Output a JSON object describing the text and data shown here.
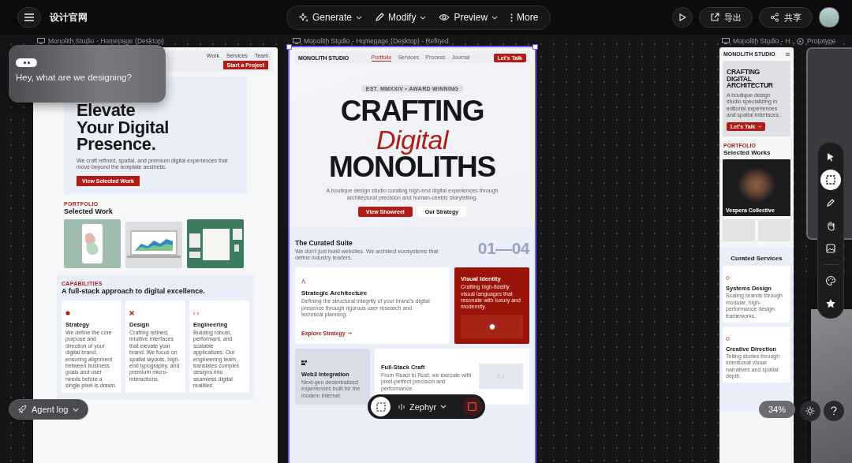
{
  "top_bar": {
    "project_title": "设计官网",
    "menu": [
      {
        "kind": "generate",
        "label": "Generate"
      },
      {
        "kind": "modify",
        "label": "Modify"
      },
      {
        "kind": "preview",
        "label": "Preview"
      },
      {
        "kind": "more",
        "label": "More"
      }
    ],
    "export_label": "导出",
    "share_label": "共享"
  },
  "chat_bubble": {
    "message": "Hey, what are we designing?"
  },
  "frames": [
    {
      "kind": "desktop",
      "title": "Monolith Studio - Homepage (Desktop)",
      "selected": false,
      "nav_links": [
        "Work",
        "Services",
        "Team"
      ],
      "nav_cta": "Start a Project",
      "hero_lines": [
        "Elevate",
        "Your Digital",
        "Presence."
      ],
      "hero_text": "We craft refined, spatial, and premium digital experiences that move beyond the template aesthetic.",
      "hero_button": "View Selected Work",
      "portfolio_eyebrow": "PORTFOLIO",
      "portfolio_title": "Selected Work",
      "capabilities_eyebrow": "CAPABILITIES",
      "capabilities_title": "A full-stack approach to digital excellence.",
      "capabilities": [
        {
          "kind": "strategy",
          "title": "Strategy",
          "text": "We define the core purpose and direction of your digital brand, ensuring alignment between business goals and user needs before a single pixel is drawn."
        },
        {
          "kind": "design",
          "title": "Design",
          "text": "Crafting refined, intuitive interfaces that elevate your brand. We focus on spatial layouts, high-end typography, and premium micro-interactions."
        },
        {
          "kind": "engineering",
          "title": "Engineering",
          "text": "Building robust, performant, and scalable applications. Our engineering team translates complex designs into seamless digital realities."
        }
      ]
    },
    {
      "kind": "refined",
      "title": "Monolith Studio - Homepage (Desktop) - Refined",
      "selected": true,
      "logo": "MONOLITH STUDIO",
      "nav_links": [
        {
          "label": "Portfolio",
          "selected": true
        },
        {
          "label": "Services",
          "selected": false
        },
        {
          "label": "Process",
          "selected": false
        },
        {
          "label": "Journal",
          "selected": false
        }
      ],
      "nav_cta": "Let's Talk",
      "badge": "EST. MMXXIV • AWARD WINNING",
      "headline": [
        "CRAFTING",
        "Digital",
        "MONOLITHS"
      ],
      "hero_text": "A boutique design studio curating high-end digital experiences through architectural precision and human-centric storytelling.",
      "primary_button": "View Showreel",
      "secondary_button": "Our Strategy",
      "suite_title": "The Curated Suite",
      "suite_text": "We don't just build websites. We architect ecosystems that define industry leaders.",
      "suite_counter": "01—04",
      "services": [
        {
          "kind": "feature",
          "title": "Strategic Architecture",
          "text": "Defining the structural integrity of your brand's digital presence through rigorous user research and technical planning.",
          "link": "Explore Strategy"
        },
        {
          "kind": "highlight",
          "title": "Visual Identity",
          "text": "Crafting high-fidelity visual languages that resonate with luxury and modernity."
        },
        {
          "kind": "muted",
          "title": "Web3 Integration",
          "text": "Next-gen decentralized experiences built for the modern internet."
        },
        {
          "kind": "wide",
          "title": "Full-Stack Craft",
          "text": "From React to Rust, we execute with pixel-perfect precision and performance."
        }
      ]
    },
    {
      "kind": "mobile",
      "title": "Monolith Studio - H...",
      "selected": false,
      "logo": "MONOLITH STUDIO",
      "hero_lines": [
        "CRAFTING",
        "DIGITAL",
        "ARCHITECTUR"
      ],
      "hero_text": "A boutique design studio specializing in editorial experiences and spatial interfaces.",
      "hero_button": "Let's Talk",
      "portfolio_eyebrow": "PORTFOLIO",
      "portfolio_title": "Selected Works",
      "project_caption": "Vespera Collective",
      "services_title": "Curated Services",
      "services": [
        {
          "title": "Systems Design",
          "text": "Scaling brands through modular, high-performance design frameworks."
        },
        {
          "title": "Creative Direction",
          "text": "Telling stories through intentional visual narratives and spatial depth."
        }
      ]
    },
    {
      "kind": "prototype",
      "title": "Prototype",
      "selected": false
    }
  ],
  "tools": [
    {
      "kind": "pointer",
      "selected": false
    },
    {
      "kind": "select",
      "selected": true
    },
    {
      "kind": "pen",
      "selected": false
    },
    {
      "kind": "hand",
      "selected": false
    },
    {
      "kind": "image",
      "selected": false
    },
    {
      "kind": "palette",
      "selected": false
    },
    {
      "kind": "star",
      "selected": false
    }
  ],
  "agent_log": {
    "label": "Agent log"
  },
  "composer": {
    "model": "Zephyr"
  },
  "zoom": "34%"
}
